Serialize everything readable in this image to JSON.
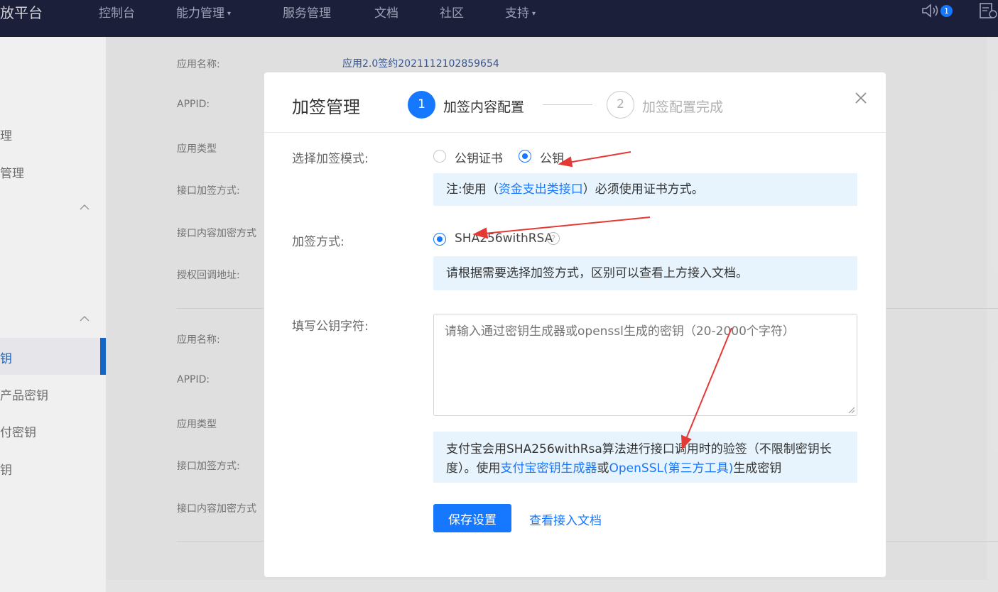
{
  "topnav": {
    "brand": "放平台",
    "items": [
      {
        "label": "控制台"
      },
      {
        "label": "能力管理",
        "caret": "▾"
      },
      {
        "label": "服务管理"
      },
      {
        "label": "文档"
      },
      {
        "label": "社区"
      },
      {
        "label": "支持",
        "caret": "▾"
      }
    ],
    "notification_count": "1",
    "icons": [
      "speaker-icon",
      "doc-icon"
    ]
  },
  "sidebar": {
    "items": [
      {
        "label": "理"
      },
      {
        "label": "管理"
      },
      {
        "label": "钥"
      },
      {
        "label": "产品密钥"
      },
      {
        "label": "付密钥"
      },
      {
        "label": "钥"
      }
    ]
  },
  "background": {
    "section1": {
      "labels": [
        "应用名称:",
        "APPID:",
        "应用类型",
        "接口加签方式:",
        "接口内容加密方式",
        "授权回调地址:"
      ],
      "app_name_value": "应用2.0签约2021112102859654"
    },
    "section2": {
      "labels": [
        "应用名称:",
        "APPID:",
        "应用类型",
        "接口加签方式:",
        "接口内容加密方式"
      ]
    }
  },
  "modal": {
    "title": "加签管理",
    "steps": [
      {
        "number": "1",
        "label": "加签内容配置",
        "active": true
      },
      {
        "number": "2",
        "label": "加签配置完成",
        "active": false
      }
    ],
    "close_label": "×",
    "mode": {
      "label": "选择加签模式:",
      "options": [
        {
          "label": "公钥证书",
          "checked": false
        },
        {
          "label": "公钥",
          "checked": true
        }
      ],
      "note_prefix": "注:使用（",
      "note_link": "资金支出类接口",
      "note_suffix": "）必须使用证书方式。"
    },
    "method": {
      "label": "加签方式:",
      "option": "SHA256withRSA",
      "help": "?",
      "note": "请根据需要选择加签方式，区别可以查看上方接入文档。"
    },
    "public_key": {
      "label": "填写公钥字符:",
      "placeholder": "请输入通过密钥生成器或openssl生成的密钥（20-2000个字符）",
      "value": "",
      "note_part1": "支付宝会用SHA256withRsa算法进行接口调用时的验签（不限制密钥长度）。使用",
      "note_link1": "支付宝密钥生成器",
      "note_mid": "或",
      "note_link2": "OpenSSL(第三方工具)",
      "note_end": "生成密钥"
    },
    "save_button": "保存设置",
    "doc_link": "查看接入文档"
  },
  "colors": {
    "primary": "#1677ff",
    "nav_bg": "#1c1f3a",
    "note_bg": "#e8f4fd",
    "annotation_arrow": "#e53935"
  }
}
